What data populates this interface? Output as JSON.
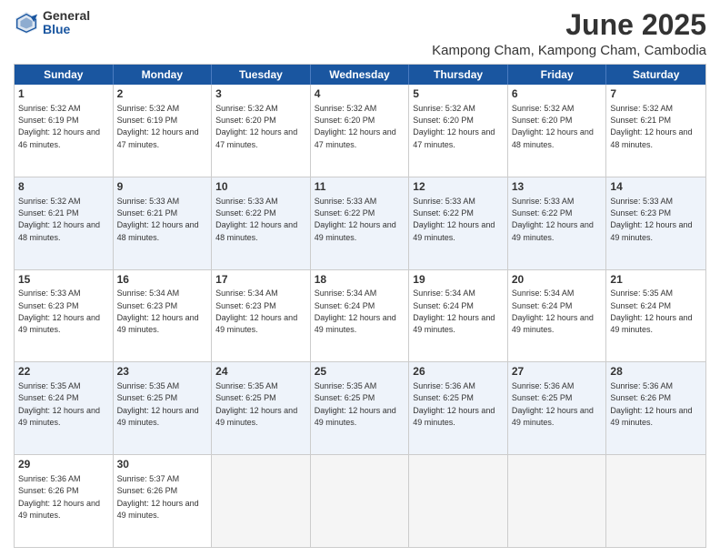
{
  "header": {
    "logo_general": "General",
    "logo_blue": "Blue",
    "month_title": "June 2025",
    "location": "Kampong Cham, Kampong Cham, Cambodia"
  },
  "weekdays": [
    "Sunday",
    "Monday",
    "Tuesday",
    "Wednesday",
    "Thursday",
    "Friday",
    "Saturday"
  ],
  "rows": [
    {
      "alt": false,
      "cells": [
        {
          "day": "1",
          "sunrise": "5:32 AM",
          "sunset": "6:19 PM",
          "daylight": "12 hours and 46 minutes."
        },
        {
          "day": "2",
          "sunrise": "5:32 AM",
          "sunset": "6:19 PM",
          "daylight": "12 hours and 47 minutes."
        },
        {
          "day": "3",
          "sunrise": "5:32 AM",
          "sunset": "6:20 PM",
          "daylight": "12 hours and 47 minutes."
        },
        {
          "day": "4",
          "sunrise": "5:32 AM",
          "sunset": "6:20 PM",
          "daylight": "12 hours and 47 minutes."
        },
        {
          "day": "5",
          "sunrise": "5:32 AM",
          "sunset": "6:20 PM",
          "daylight": "12 hours and 47 minutes."
        },
        {
          "day": "6",
          "sunrise": "5:32 AM",
          "sunset": "6:20 PM",
          "daylight": "12 hours and 48 minutes."
        },
        {
          "day": "7",
          "sunrise": "5:32 AM",
          "sunset": "6:21 PM",
          "daylight": "12 hours and 48 minutes."
        }
      ]
    },
    {
      "alt": true,
      "cells": [
        {
          "day": "8",
          "sunrise": "5:32 AM",
          "sunset": "6:21 PM",
          "daylight": "12 hours and 48 minutes."
        },
        {
          "day": "9",
          "sunrise": "5:33 AM",
          "sunset": "6:21 PM",
          "daylight": "12 hours and 48 minutes."
        },
        {
          "day": "10",
          "sunrise": "5:33 AM",
          "sunset": "6:22 PM",
          "daylight": "12 hours and 48 minutes."
        },
        {
          "day": "11",
          "sunrise": "5:33 AM",
          "sunset": "6:22 PM",
          "daylight": "12 hours and 49 minutes."
        },
        {
          "day": "12",
          "sunrise": "5:33 AM",
          "sunset": "6:22 PM",
          "daylight": "12 hours and 49 minutes."
        },
        {
          "day": "13",
          "sunrise": "5:33 AM",
          "sunset": "6:22 PM",
          "daylight": "12 hours and 49 minutes."
        },
        {
          "day": "14",
          "sunrise": "5:33 AM",
          "sunset": "6:23 PM",
          "daylight": "12 hours and 49 minutes."
        }
      ]
    },
    {
      "alt": false,
      "cells": [
        {
          "day": "15",
          "sunrise": "5:33 AM",
          "sunset": "6:23 PM",
          "daylight": "12 hours and 49 minutes."
        },
        {
          "day": "16",
          "sunrise": "5:34 AM",
          "sunset": "6:23 PM",
          "daylight": "12 hours and 49 minutes."
        },
        {
          "day": "17",
          "sunrise": "5:34 AM",
          "sunset": "6:23 PM",
          "daylight": "12 hours and 49 minutes."
        },
        {
          "day": "18",
          "sunrise": "5:34 AM",
          "sunset": "6:24 PM",
          "daylight": "12 hours and 49 minutes."
        },
        {
          "day": "19",
          "sunrise": "5:34 AM",
          "sunset": "6:24 PM",
          "daylight": "12 hours and 49 minutes."
        },
        {
          "day": "20",
          "sunrise": "5:34 AM",
          "sunset": "6:24 PM",
          "daylight": "12 hours and 49 minutes."
        },
        {
          "day": "21",
          "sunrise": "5:35 AM",
          "sunset": "6:24 PM",
          "daylight": "12 hours and 49 minutes."
        }
      ]
    },
    {
      "alt": true,
      "cells": [
        {
          "day": "22",
          "sunrise": "5:35 AM",
          "sunset": "6:24 PM",
          "daylight": "12 hours and 49 minutes."
        },
        {
          "day": "23",
          "sunrise": "5:35 AM",
          "sunset": "6:25 PM",
          "daylight": "12 hours and 49 minutes."
        },
        {
          "day": "24",
          "sunrise": "5:35 AM",
          "sunset": "6:25 PM",
          "daylight": "12 hours and 49 minutes."
        },
        {
          "day": "25",
          "sunrise": "5:35 AM",
          "sunset": "6:25 PM",
          "daylight": "12 hours and 49 minutes."
        },
        {
          "day": "26",
          "sunrise": "5:36 AM",
          "sunset": "6:25 PM",
          "daylight": "12 hours and 49 minutes."
        },
        {
          "day": "27",
          "sunrise": "5:36 AM",
          "sunset": "6:25 PM",
          "daylight": "12 hours and 49 minutes."
        },
        {
          "day": "28",
          "sunrise": "5:36 AM",
          "sunset": "6:26 PM",
          "daylight": "12 hours and 49 minutes."
        }
      ]
    },
    {
      "alt": false,
      "cells": [
        {
          "day": "29",
          "sunrise": "5:36 AM",
          "sunset": "6:26 PM",
          "daylight": "12 hours and 49 minutes."
        },
        {
          "day": "30",
          "sunrise": "5:37 AM",
          "sunset": "6:26 PM",
          "daylight": "12 hours and 49 minutes."
        },
        {
          "day": "",
          "sunrise": "",
          "sunset": "",
          "daylight": ""
        },
        {
          "day": "",
          "sunrise": "",
          "sunset": "",
          "daylight": ""
        },
        {
          "day": "",
          "sunrise": "",
          "sunset": "",
          "daylight": ""
        },
        {
          "day": "",
          "sunrise": "",
          "sunset": "",
          "daylight": ""
        },
        {
          "day": "",
          "sunrise": "",
          "sunset": "",
          "daylight": ""
        }
      ]
    }
  ]
}
